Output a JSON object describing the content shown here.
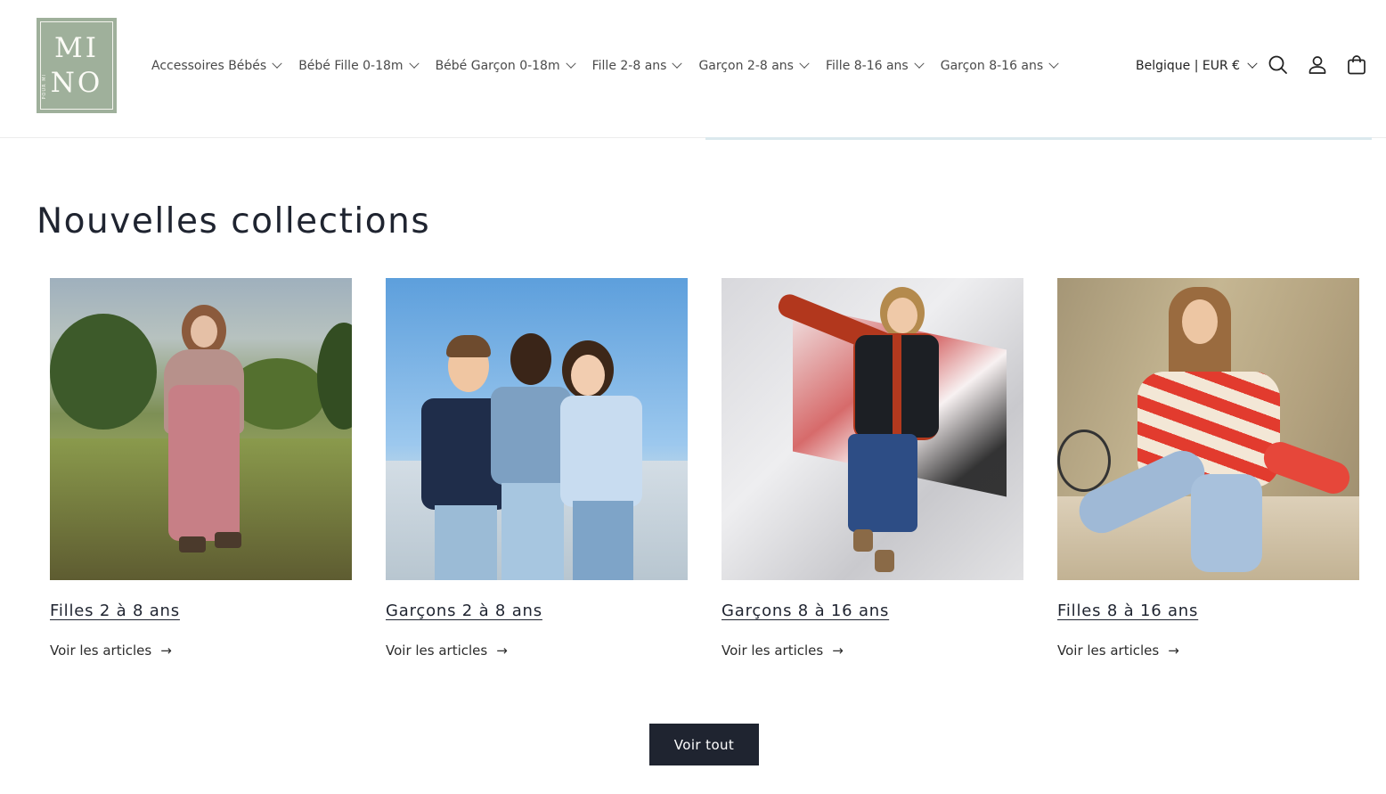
{
  "brand": {
    "logo_line1": "MI",
    "logo_line2": "NO",
    "logo_sub": "POUR MI"
  },
  "nav": {
    "items": [
      "Accessoires Bébés",
      "Bébé Fille 0-18m",
      "Bébé Garçon 0-18m",
      "Fille 2-8 ans",
      "Garçon 2-8 ans",
      "Fille 8-16 ans",
      "Garçon 8-16 ans"
    ]
  },
  "header": {
    "locale": "Belgique | EUR €",
    "icons": [
      "search-icon",
      "account-icon",
      "cart-icon"
    ]
  },
  "section": {
    "title": "Nouvelles collections"
  },
  "collections": [
    {
      "title": "Filles 2 à 8 ans",
      "link": "Voir les articles",
      "arrow": "→"
    },
    {
      "title": "Garçons 2 à 8 ans",
      "link": "Voir les articles",
      "arrow": "→"
    },
    {
      "title": "Garçons 8 à 16 ans",
      "link": "Voir les articles",
      "arrow": "→"
    },
    {
      "title": "Filles 8 à 16 ans",
      "link": "Voir les articles",
      "arrow": "→"
    }
  ],
  "cta": {
    "label": "Voir tout"
  },
  "colors": {
    "logo_bg": "#9fb09b",
    "text_dark": "#1f2430",
    "button_bg": "#1f2430"
  }
}
